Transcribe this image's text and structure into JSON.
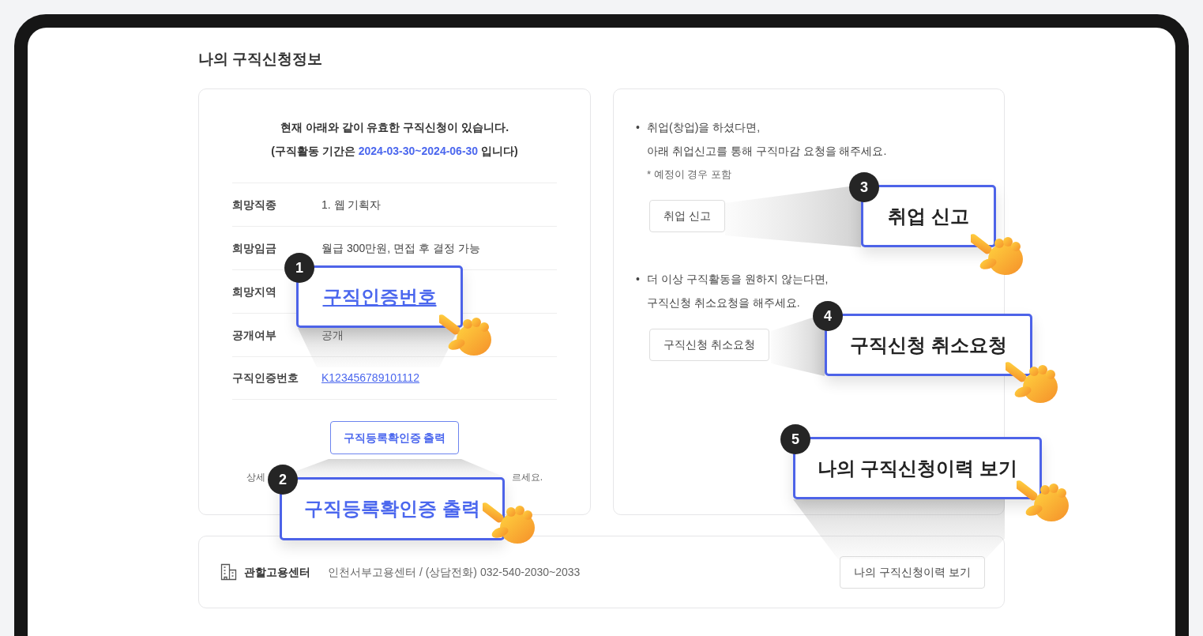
{
  "page_title": "나의 구직신청정보",
  "application_card": {
    "notice": "현재 아래와 같이 유효한 구직신청이 있습니다.",
    "period_before": "(구직활동 기간은",
    "period": "2024-03-30~2024-06-30",
    "period_after": "입니다)",
    "details": [
      {
        "label": "희망직종",
        "value": "1. 웹 기획자",
        "kind": "text"
      },
      {
        "label": "희망임금",
        "value": "월급 300만원, 면접 후 결정 가능",
        "kind": "text"
      },
      {
        "label": "희망지역",
        "kind": "hidden"
      },
      {
        "label": "공개여부",
        "value": "공개",
        "kind": "text"
      },
      {
        "label": "구직인증번호",
        "value": "K123456789101112",
        "kind": "link"
      }
    ],
    "print_button": "구직등록확인증 출력",
    "help_start": "상세",
    "help_end": "르세요."
  },
  "actions_card": {
    "sections": [
      {
        "marker": "•",
        "lines": [
          "취업(창업)을 하셨다면,",
          "아래 취업신고를 통해 구직마감 요청을 해주세요."
        ],
        "note": "* 예정이 경우 포함",
        "button": "취업 신고"
      },
      {
        "marker": "•",
        "lines": [
          "더 이상 구직활동을 원하지 않는다면,",
          "구직신청 취소요청을 해주세요."
        ],
        "button": "구직신청 취소요청"
      }
    ]
  },
  "center_card": {
    "label": "관할고용센터",
    "value": "인천서부고용센터 / (상담전화) 032-540-2030~2033",
    "button": "나의 구직신청이력 보기"
  },
  "callouts": [
    {
      "number": "1",
      "text": "구직인증번호",
      "kind": "link"
    },
    {
      "number": "2",
      "text": "구직등록확인증 출력",
      "kind": "accent"
    },
    {
      "number": "3",
      "text": "취업 신고",
      "kind": "plain"
    },
    {
      "number": "4",
      "text": "구직신청 취소요청",
      "kind": "plain"
    },
    {
      "number": "5",
      "text": "나의 구직신청이력 보기",
      "kind": "plain"
    }
  ]
}
